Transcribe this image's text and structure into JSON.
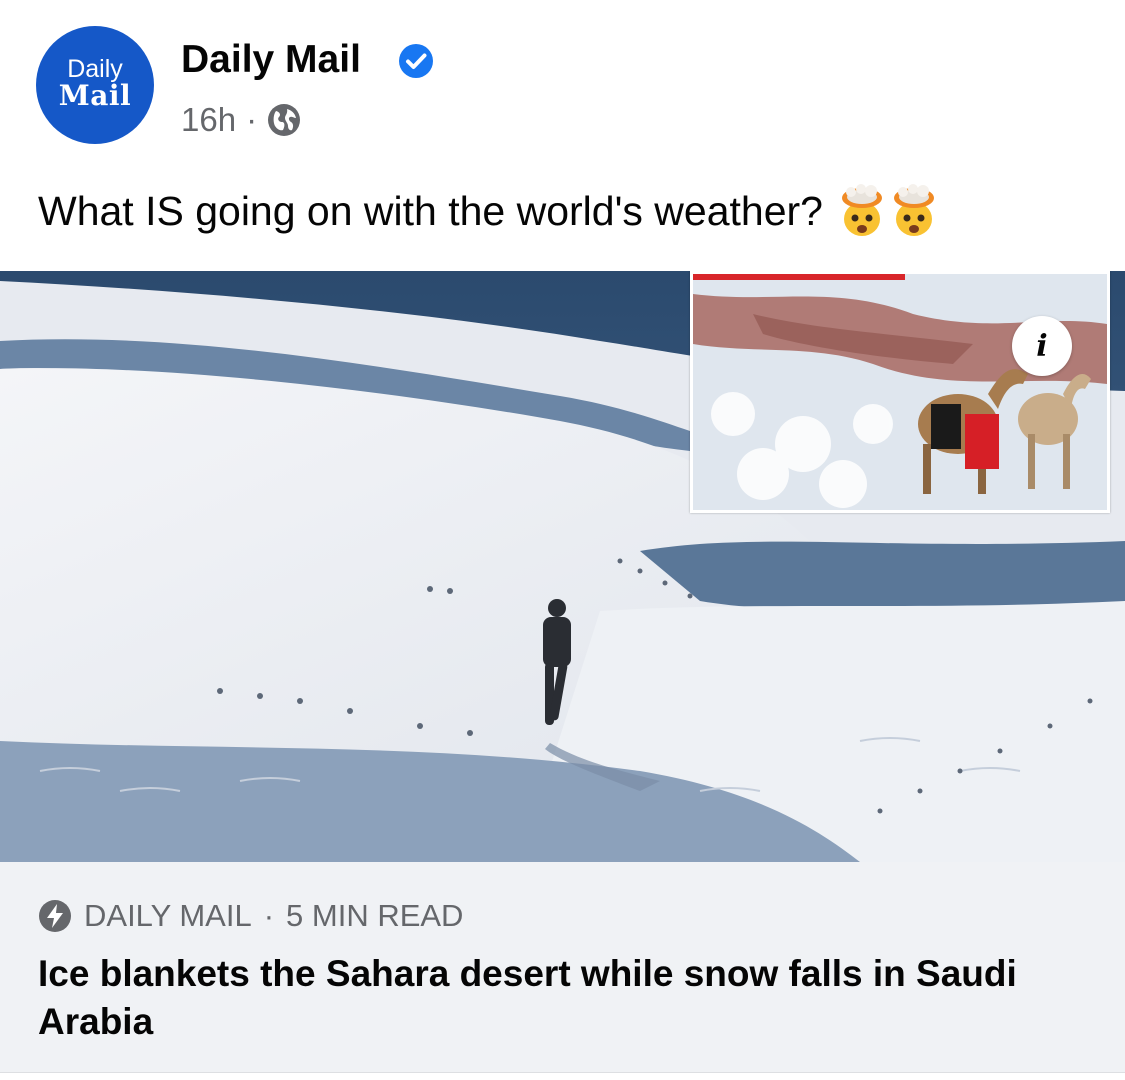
{
  "post": {
    "avatar": {
      "line1": "Daily",
      "line2": "Mail",
      "color": "#1558c8"
    },
    "page_name": "Daily Mail",
    "verified": true,
    "time": "16h",
    "separator": "·",
    "audience_icon": "globe-icon",
    "caption": "What IS going on with the world's weather?",
    "caption_emojis": [
      "exploding-head-emoji",
      "exploding-head-emoji"
    ]
  },
  "link_preview": {
    "image_alt": "Man walking on snow-covered sand dunes, inset of camels in snow",
    "info_label": "i",
    "source": "DAILY MAIL",
    "separator": "·",
    "read_time": "5 MIN READ",
    "source_icon": "lightning-bolt-icon",
    "headline": "Ice blankets the Sahara desert while snow falls in Saudi Arabia"
  },
  "colors": {
    "accent": "#1877f2",
    "secondary_text": "#65676b",
    "footer_bg": "#f0f2f5"
  }
}
